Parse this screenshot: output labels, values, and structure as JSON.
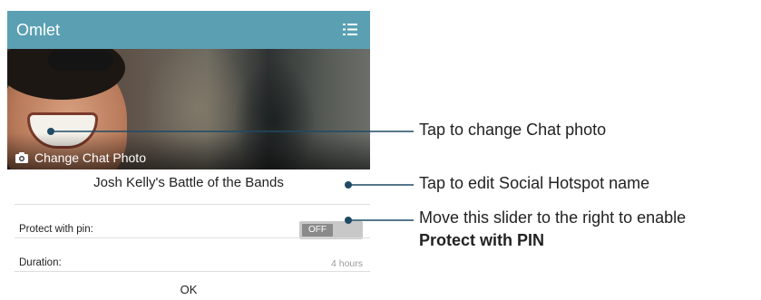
{
  "app": {
    "title": "Omlet",
    "menu_icon": "list-menu-icon"
  },
  "photo": {
    "change_label": "Change Chat Photo",
    "camera_icon": "camera-icon"
  },
  "chat_name": "Josh Kelly's Battle of the Bands",
  "settings": {
    "pin_label": "Protect with pin:",
    "pin_toggle_state": "OFF",
    "duration_label": "Duration:",
    "duration_value": "4 hours"
  },
  "ok_label": "OK",
  "callouts": {
    "photo": "Tap to change Chat photo",
    "name": "Tap to edit Social Hotspot name",
    "slider_line1": "Move this slider to the right to enable",
    "slider_line2": "Protect with PIN"
  },
  "colors": {
    "appbar": "#5aa0b2",
    "callout_line": "#1f4a66"
  }
}
